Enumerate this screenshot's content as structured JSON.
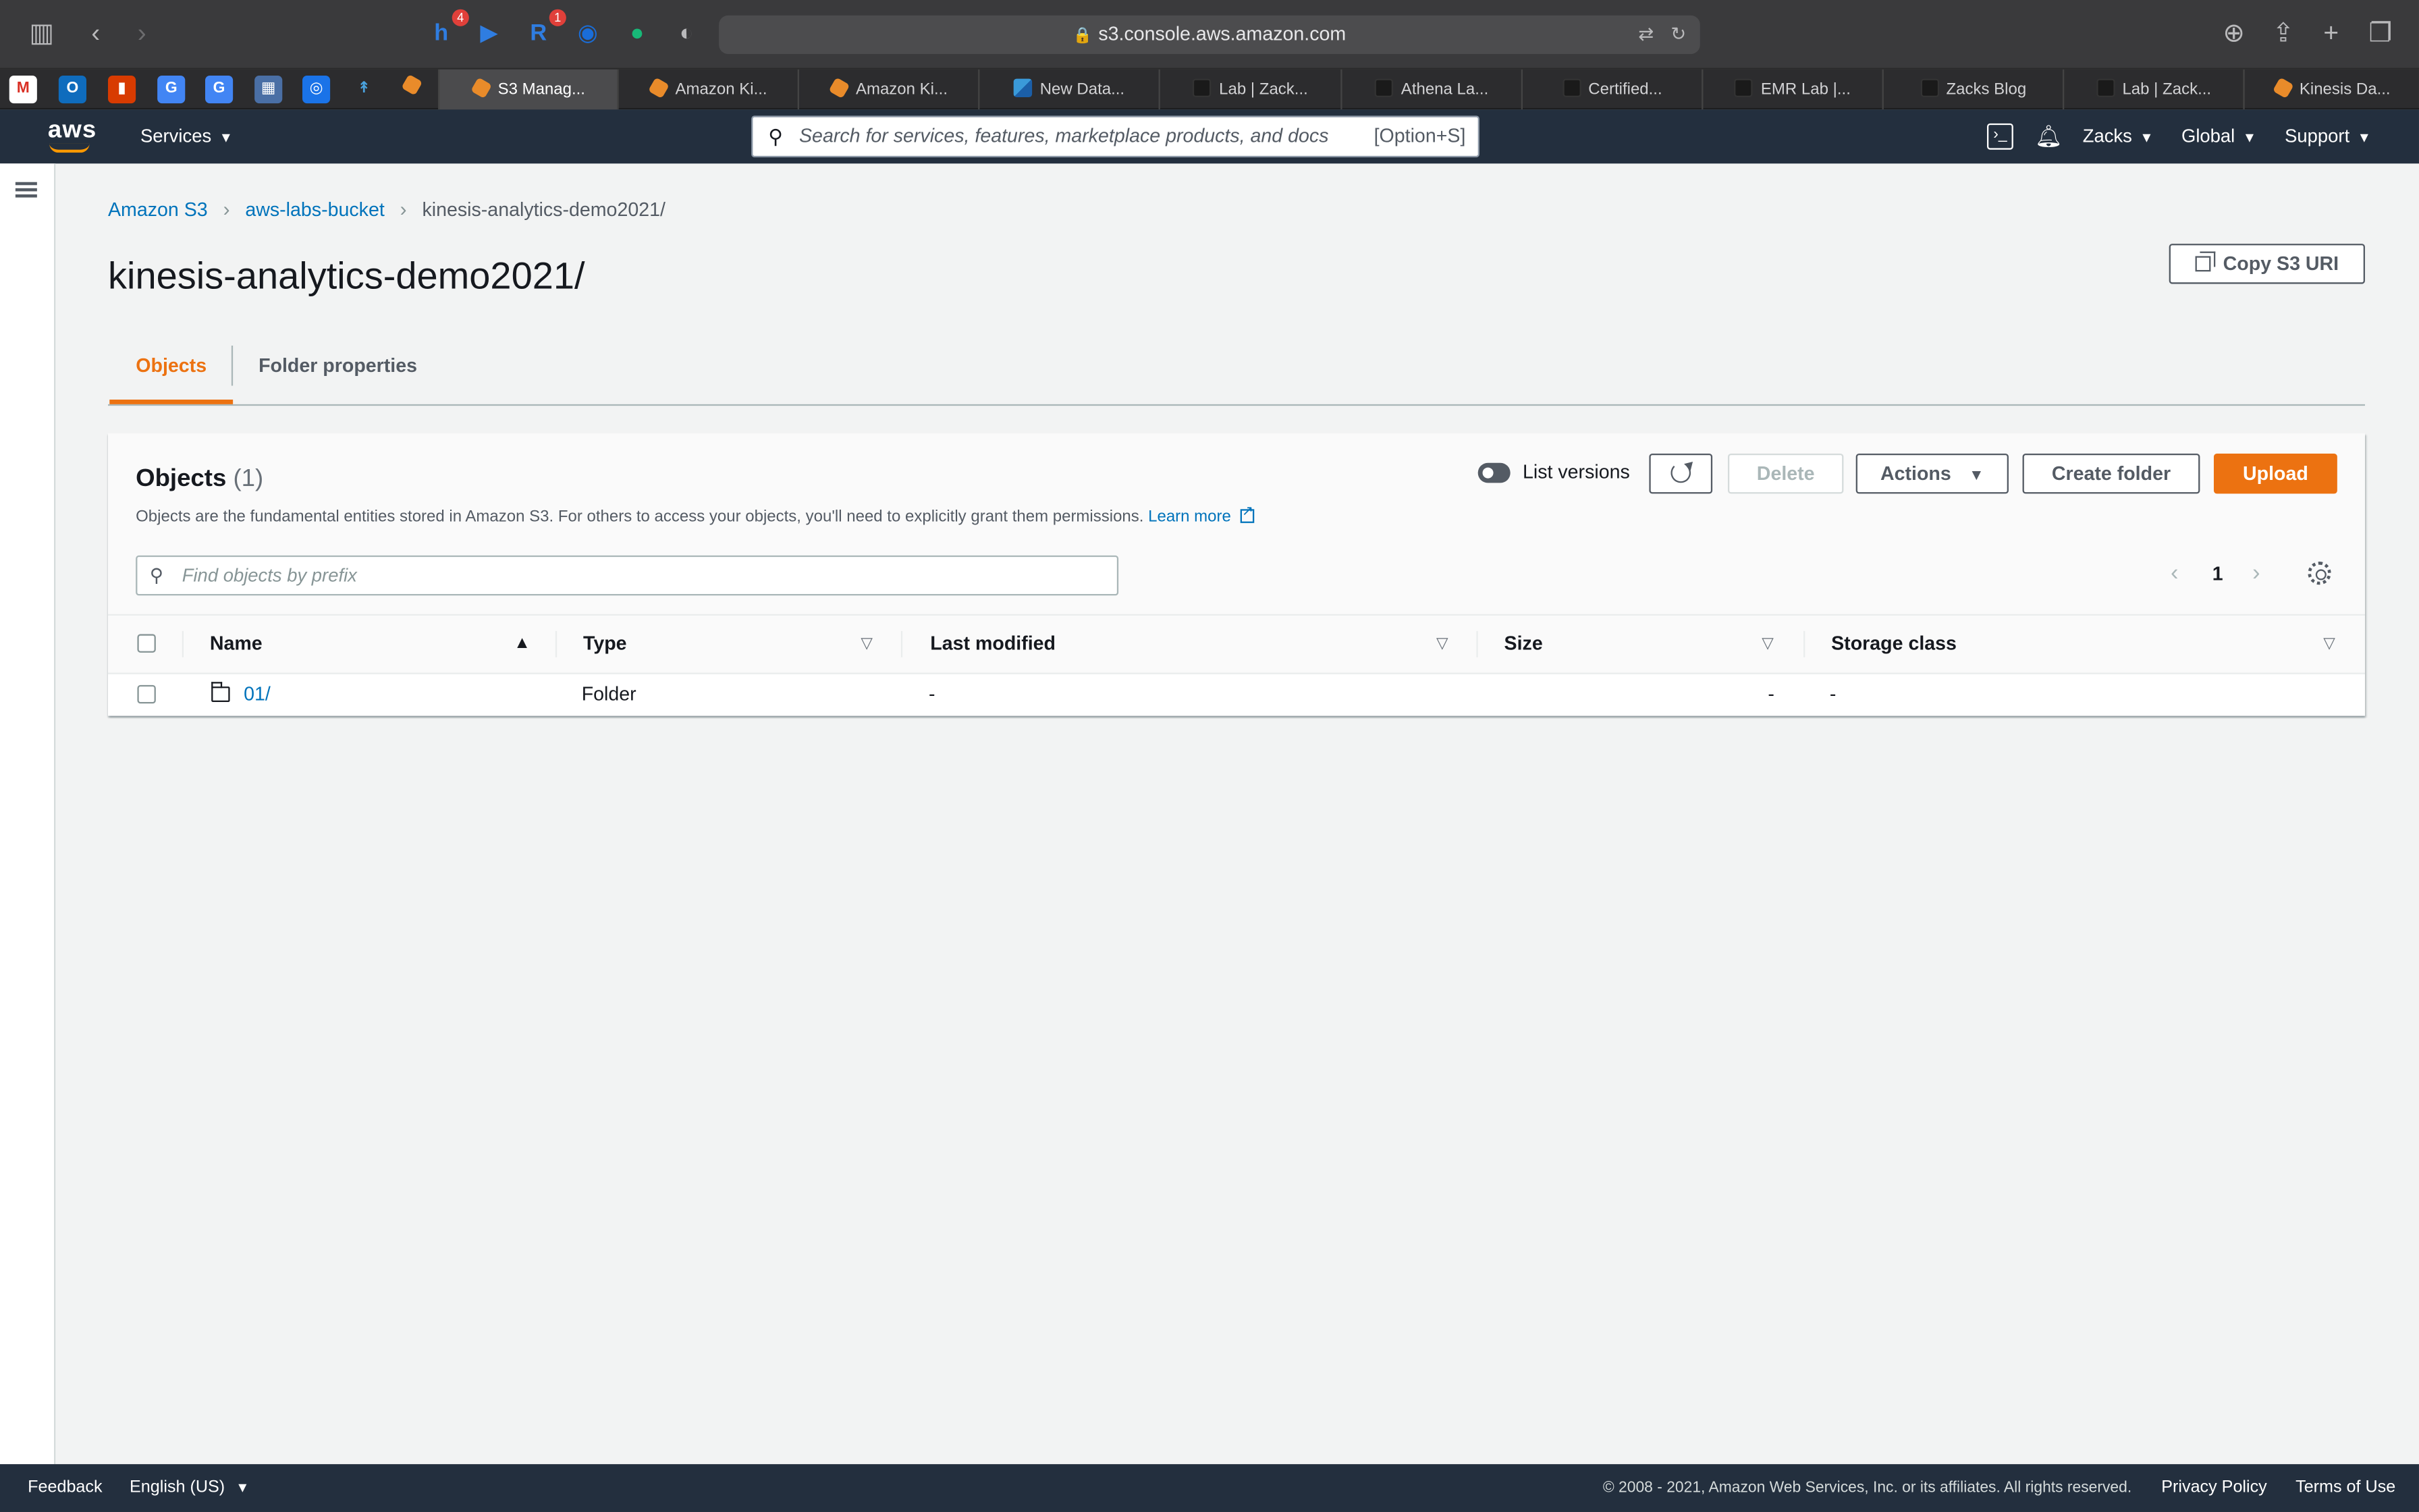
{
  "browser": {
    "url": "s3.console.aws.amazon.com",
    "extension_badges": {
      "honey": "4",
      "readwise": "1"
    },
    "pinned_tabs": [
      "gmail",
      "outlook",
      "office",
      "translate",
      "translate",
      "grid",
      "chrome",
      "arrow",
      "aws"
    ],
    "tabs": [
      {
        "label": "S3 Manag...",
        "active": true
      },
      {
        "label": "Amazon Ki..."
      },
      {
        "label": "Amazon Ki..."
      },
      {
        "label": "New Data..."
      },
      {
        "label": "Lab | Zack..."
      },
      {
        "label": "Athena La..."
      },
      {
        "label": "Certified..."
      },
      {
        "label": "EMR Lab |..."
      },
      {
        "label": "Zacks Blog"
      },
      {
        "label": "Lab | Zack..."
      },
      {
        "label": "Kinesis Da..."
      }
    ]
  },
  "nav": {
    "logo": "aws",
    "services": "Services",
    "search_placeholder": "Search for services, features, marketplace products, and docs",
    "search_shortcut": "[Option+S]",
    "user": "Zacks",
    "region": "Global",
    "support": "Support"
  },
  "breadcrumb": {
    "root": "Amazon S3",
    "bucket": "aws-labs-bucket",
    "current": "kinesis-analytics-demo2021/"
  },
  "page": {
    "title": "kinesis-analytics-demo2021/",
    "copy_uri": "Copy S3 URI"
  },
  "tabs": {
    "objects": "Objects",
    "properties": "Folder properties"
  },
  "objects": {
    "title": "Objects",
    "count": "(1)",
    "description": "Objects are the fundamental entities stored in Amazon S3. For others to access your objects, you'll need to explicitly grant them permissions.",
    "learn_more": "Learn more",
    "list_versions": "List versions",
    "delete": "Delete",
    "actions": "Actions",
    "create_folder": "Create folder",
    "upload": "Upload",
    "find_placeholder": "Find objects by prefix",
    "page": "1",
    "columns": {
      "name": "Name",
      "type": "Type",
      "last_modified": "Last modified",
      "size": "Size",
      "storage_class": "Storage class"
    },
    "rows": [
      {
        "name": "01/",
        "type": "Folder",
        "last_modified": "-",
        "size": "-",
        "storage_class": "-"
      }
    ]
  },
  "footer": {
    "feedback": "Feedback",
    "language": "English (US)",
    "copyright": "© 2008 - 2021, Amazon Web Services, Inc. or its affiliates. All rights reserved.",
    "privacy": "Privacy Policy",
    "terms": "Terms of Use"
  },
  "colors": {
    "accent": "#ec7211",
    "link": "#0073bb",
    "nav_bg": "#232f3e"
  }
}
